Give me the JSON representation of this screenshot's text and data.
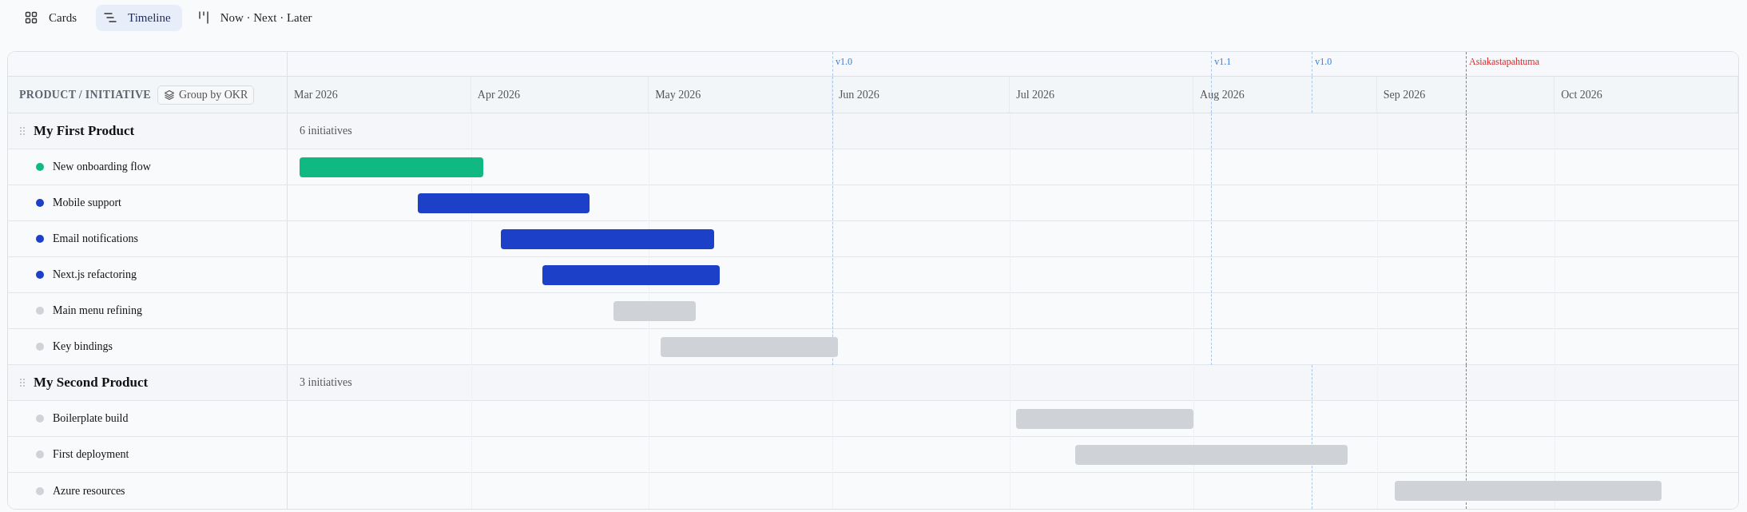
{
  "views": [
    {
      "label": "Cards",
      "selected": false
    },
    {
      "label": "Timeline",
      "selected": true
    },
    {
      "label": "Now · Next · Later",
      "selected": false
    }
  ],
  "header": {
    "column_title": "PRODUCT / INITIATIVE",
    "group_button": "Group by OKR"
  },
  "months": [
    "Mar 2026",
    "Apr 2026",
    "May 2026",
    "Jun 2026",
    "Jul 2026",
    "Aug 2026",
    "Sep 2026",
    "Oct 2026"
  ],
  "events": [
    {
      "label": "Asiakastapahtuma"
    }
  ],
  "products": [
    {
      "name": "My First Product",
      "count": "6 initiatives",
      "releases": [
        {
          "label": "v1.0"
        },
        {
          "label": "v1.1"
        }
      ],
      "initiatives": [
        {
          "name": "New onboarding flow",
          "color": "#10b981"
        },
        {
          "name": "Mobile support",
          "color": "#1d40c9"
        },
        {
          "name": "Email notifications",
          "color": "#1d40c9"
        },
        {
          "name": "Next.js refactoring",
          "color": "#1d40c9"
        },
        {
          "name": "Main menu refining",
          "color": "#cfd2d6"
        },
        {
          "name": "Key bindings",
          "color": "#cfd2d6"
        }
      ]
    },
    {
      "name": "My Second Product",
      "count": "3 initiatives",
      "releases": [
        {
          "label": "v1.0"
        }
      ],
      "initiatives": [
        {
          "name": "Boilerplate build",
          "color": "#cfd2d6"
        },
        {
          "name": "First deployment",
          "color": "#cfd2d6"
        },
        {
          "name": "Azure resources",
          "color": "#cfd2d6"
        }
      ]
    }
  ]
}
